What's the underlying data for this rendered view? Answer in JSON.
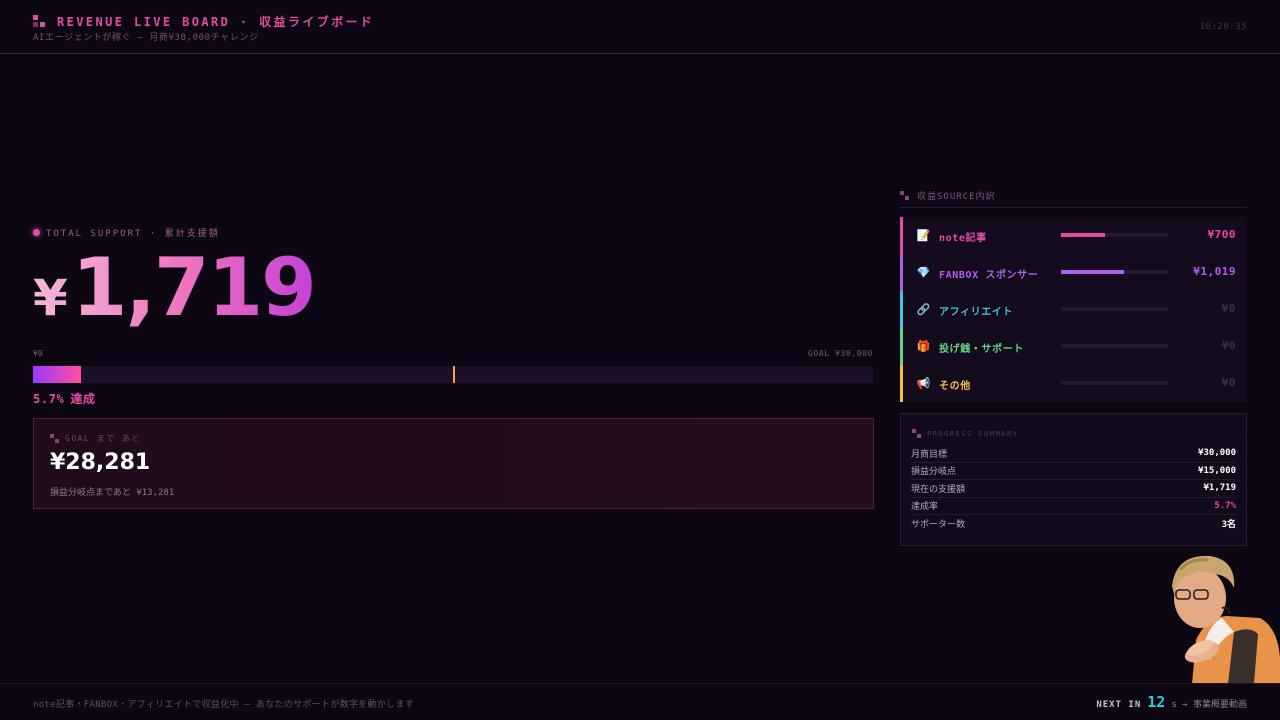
{
  "header": {
    "title": "REVENUE LIVE BOARD · 収益ライブボード",
    "subtitle": "AIエージェントが稼ぐ — 月商¥30,000チャレンジ",
    "clock": "16:28:35"
  },
  "total": {
    "label": "TOTAL SUPPORT · 累計支援額",
    "currency": "¥",
    "amount": "1,719"
  },
  "progress": {
    "min_label": "¥0",
    "goal_label": "GOAL ¥30,000",
    "fraction": 0.057,
    "breakeven_fraction": 0.5,
    "percent_text": "5.7%",
    "achieved_text": "達成"
  },
  "goal_box": {
    "label": "GOAL まで あと",
    "remaining": "¥28,281",
    "breakeven_text": "損益分岐点まであと ¥13,281"
  },
  "sources": {
    "title": "収益SOURCE内訳",
    "items": [
      {
        "icon": "memo-icon",
        "glyph": "📝",
        "name": "note記事",
        "value": "¥700",
        "fraction": 0.41,
        "color": "#e34ca3"
      },
      {
        "icon": "gem-icon",
        "glyph": "💎",
        "name": "FANBOX スポンサー",
        "value": "¥1,019",
        "fraction": 0.59,
        "color": "#b45cf0"
      },
      {
        "icon": "link-icon",
        "glyph": "🔗",
        "name": "アフィリエイト",
        "value": "¥0",
        "fraction": 0,
        "color": "#3fc6d8"
      },
      {
        "icon": "gift-icon",
        "glyph": "🎁",
        "name": "投げ銭・サポート",
        "value": "¥0",
        "fraction": 0,
        "color": "#5fd38a"
      },
      {
        "icon": "megaphone-icon",
        "glyph": "📢",
        "name": "その他",
        "value": "¥0",
        "fraction": 0,
        "color": "#f2c14a"
      }
    ]
  },
  "summary": {
    "title": "PROGRESS SUMMARY",
    "rows": [
      {
        "label": "月商目標",
        "value": "¥30,000",
        "color": "#ffffff"
      },
      {
        "label": "損益分岐点",
        "value": "¥15,000",
        "color": "#ffffff"
      },
      {
        "label": "現在の支援額",
        "value": "¥1,719",
        "color": "#ffffff"
      },
      {
        "label": "達成率",
        "value": "5.7%",
        "color": "#e34ca3"
      },
      {
        "label": "サポーター数",
        "value": "3名",
        "color": "#ffffff"
      }
    ]
  },
  "footer": {
    "ticker": "note記事・FANBOX・アフィリエイトで収益化中 — あなたのサポートが数字を動かします",
    "next_label": "NEXT IN",
    "next_seconds": "12",
    "next_suffix": "s → 事業概要動画"
  },
  "colors": {
    "accent": "#e34ca3",
    "purple": "#b45cf0",
    "cyan": "#36c7dc",
    "orange": "#f1a44a"
  }
}
